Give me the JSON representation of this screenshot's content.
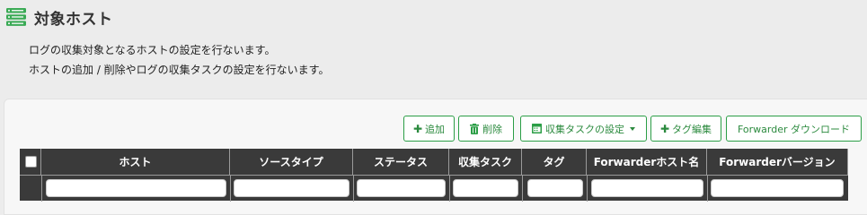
{
  "header": {
    "title": "対象ホスト"
  },
  "description": {
    "line1": "ログの収集対象となるホストの設定を行ないます。",
    "line2": "ホストの追加 / 削除やログの収集タスクの設定を行ないます。"
  },
  "toolbar": {
    "add_label": "追加",
    "delete_label": "削除",
    "task_settings_label": "収集タスクの設定",
    "tag_edit_label": "タグ編集",
    "forwarder_download_label": "Forwarder ダウンロード"
  },
  "colors": {
    "accent_green": "#2b9e46",
    "table_header_bg": "#3a3a3a",
    "page_bg": "#ececec"
  },
  "table": {
    "columns": [
      "ホスト",
      "ソースタイプ",
      "ステータス",
      "収集タスク",
      "タグ",
      "Forwarderホスト名",
      "Forwarderバージョン"
    ],
    "filters": [
      "",
      "",
      "",
      "",
      "",
      "",
      ""
    ]
  }
}
